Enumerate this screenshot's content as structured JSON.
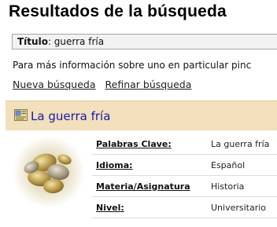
{
  "header": {
    "title": "Resultados de la búsqueda"
  },
  "query": {
    "label": "Título",
    "value": "guerra fría"
  },
  "info": {
    "text": "Para más información sobre uno en particular pinc"
  },
  "links": {
    "new_search": "Nueva búsqueda",
    "refine_search": "Refinar búsqueda"
  },
  "result": {
    "title": "La guerra fría",
    "icon": "document-icon",
    "thumbnail": "coins-image",
    "fields": [
      {
        "label": "Palabras Clave:",
        "value": "La guerra fría"
      },
      {
        "label": "Idioma:",
        "value": "Español"
      },
      {
        "label": "Materia/Asignatura",
        "value": "Historia"
      },
      {
        "label": "Nivel:",
        "value": "Universitario"
      }
    ]
  },
  "colors": {
    "result_header_bg": "#f2dfbc",
    "result_title": "#1a1aa6"
  }
}
